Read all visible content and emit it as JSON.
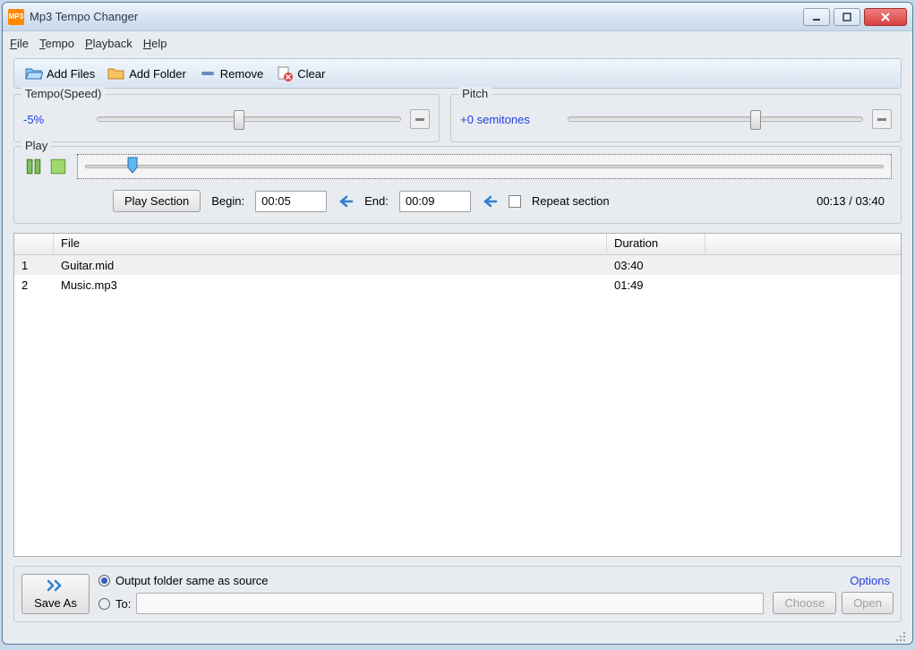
{
  "window": {
    "title": "Mp3 Tempo Changer",
    "app_icon_text": "MP3"
  },
  "menu": {
    "file": "File",
    "tempo": "Tempo",
    "playback": "Playback",
    "help": "Help"
  },
  "toolbar": {
    "add_files": "Add Files",
    "add_folder": "Add Folder",
    "remove": "Remove",
    "clear": "Clear"
  },
  "tempo": {
    "legend": "Tempo(Speed)",
    "value": "-5%",
    "slider_percent": 45
  },
  "pitch": {
    "legend": "Pitch",
    "value": "+0 semitones",
    "slider_percent": 62
  },
  "play": {
    "legend": "Play",
    "play_section": "Play Section",
    "begin_label": "Begin:",
    "begin_value": "00:05",
    "end_label": "End:",
    "end_value": "00:09",
    "repeat_label": "Repeat section",
    "time_display": "00:13 / 03:40",
    "progress_percent": 6
  },
  "filelist": {
    "headers": {
      "file": "File",
      "duration": "Duration"
    },
    "rows": [
      {
        "num": "1",
        "file": "Guitar.mid",
        "duration": "03:40",
        "selected": true
      },
      {
        "num": "2",
        "file": "Music.mp3",
        "duration": "01:49",
        "selected": false
      }
    ]
  },
  "output": {
    "save_as": "Save As",
    "same_as_source": "Output folder same as source",
    "to_label": "To:",
    "choose": "Choose",
    "open": "Open",
    "options": "Options"
  }
}
